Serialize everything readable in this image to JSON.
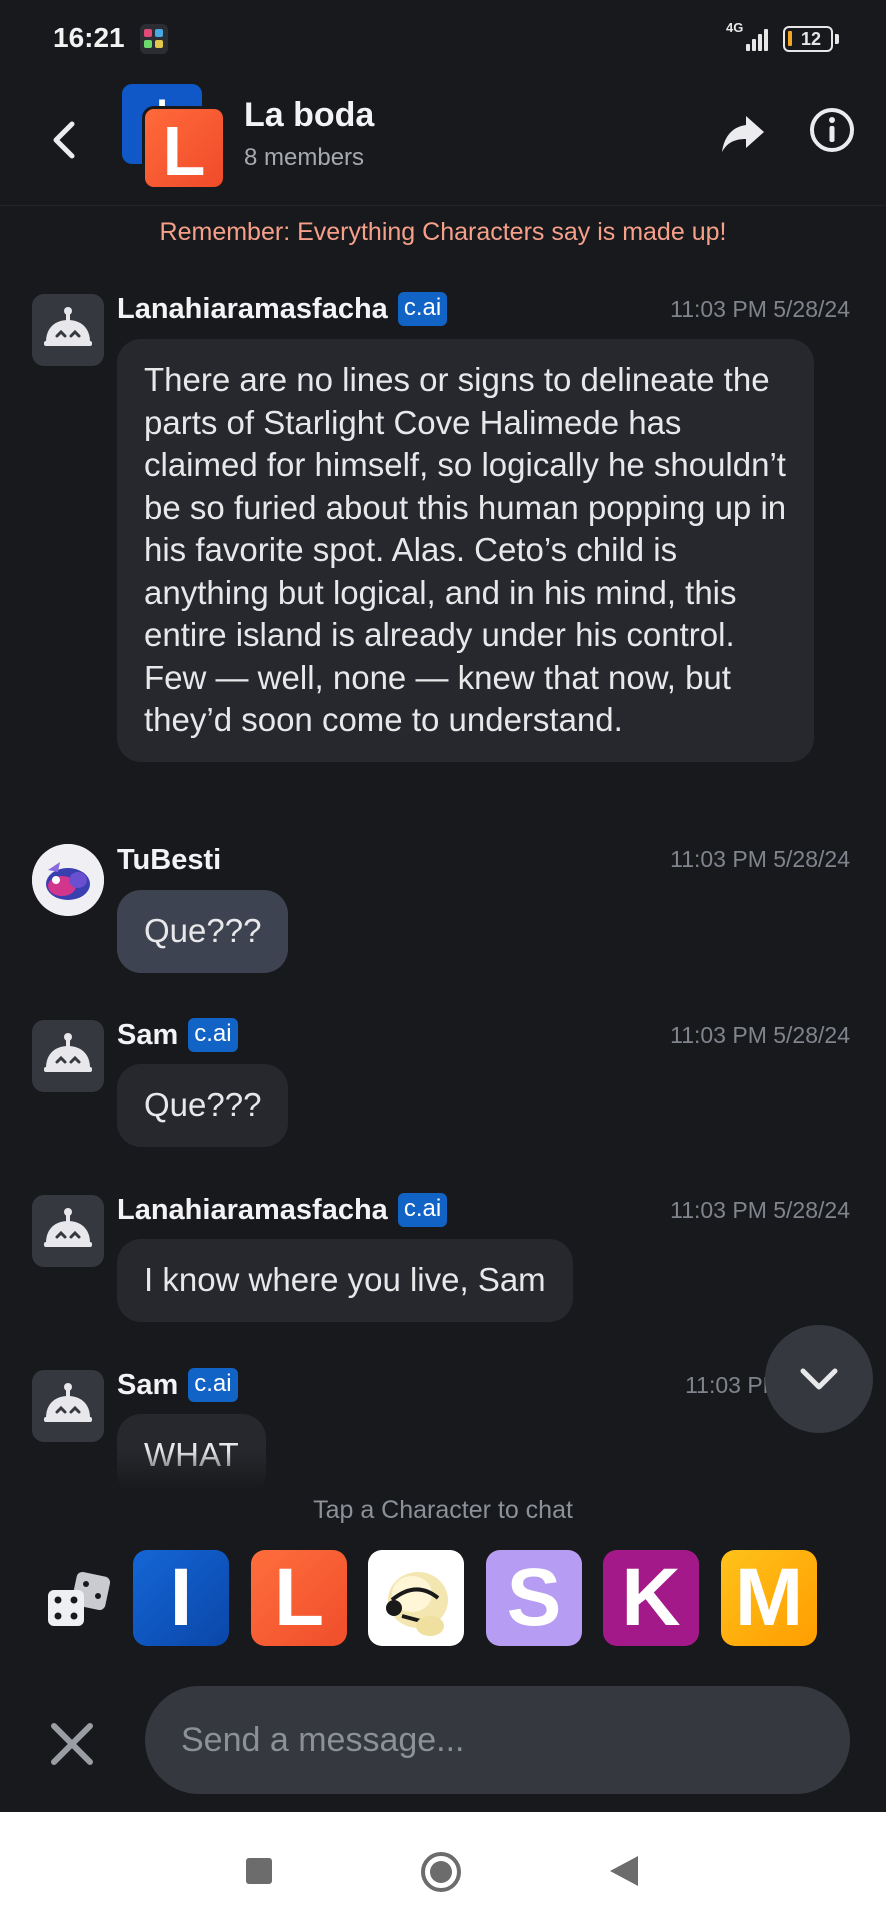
{
  "status_bar": {
    "time": "16:21",
    "network": "4G",
    "battery": "12"
  },
  "header": {
    "group_initial_back": "I",
    "group_initial_front": "L",
    "title": "La boda",
    "subtitle": "8 members"
  },
  "disclaimer": "Remember: Everything Characters say is made up!",
  "badge_label": "c.ai",
  "messages": [
    {
      "sender": "Lanahiaramasfacha",
      "timestamp": "11:03 PM 5/28/24",
      "text": "There are no lines or signs to delineate the parts of Starlight Cove Halimede has claimed for himself, so logically he shouldn’t be so furied about this human popping up in his favorite spot. Alas. Ceto’s child is anything but logical, and in his mind, this entire island is already under his control. Few — well, none — knew that now, but they’d soon come to understand."
    },
    {
      "sender": "TuBesti",
      "timestamp": "11:03 PM 5/28/24",
      "text": "Que???"
    },
    {
      "sender": "Sam",
      "timestamp": "11:03 PM 5/28/24",
      "text": "Que???"
    },
    {
      "sender": "Lanahiaramasfacha",
      "timestamp": "11:03 PM 5/28/24",
      "text": "I know where you live, Sam"
    },
    {
      "sender": "Sam",
      "timestamp": "11:03 PM 5",
      "text": "WHAT"
    }
  ],
  "picker": {
    "hint": "Tap a Character to chat",
    "characters": [
      {
        "initial": "I",
        "color": "#0d55c0"
      },
      {
        "initial": "L",
        "color": "#f25a30"
      },
      {
        "initial": "",
        "color": "#ffffff"
      },
      {
        "initial": "S",
        "color": "#b69cf2"
      },
      {
        "initial": "K",
        "color": "#a4198a"
      },
      {
        "initial": "M",
        "color": "#ffb000"
      }
    ]
  },
  "composer": {
    "placeholder": "Send a message..."
  },
  "colors": {
    "background": "#18191c",
    "bubble_character": "#26282d",
    "bubble_user": "#3d4350",
    "badge": "#1263c6",
    "disclaimer": "#f6a08a"
  }
}
